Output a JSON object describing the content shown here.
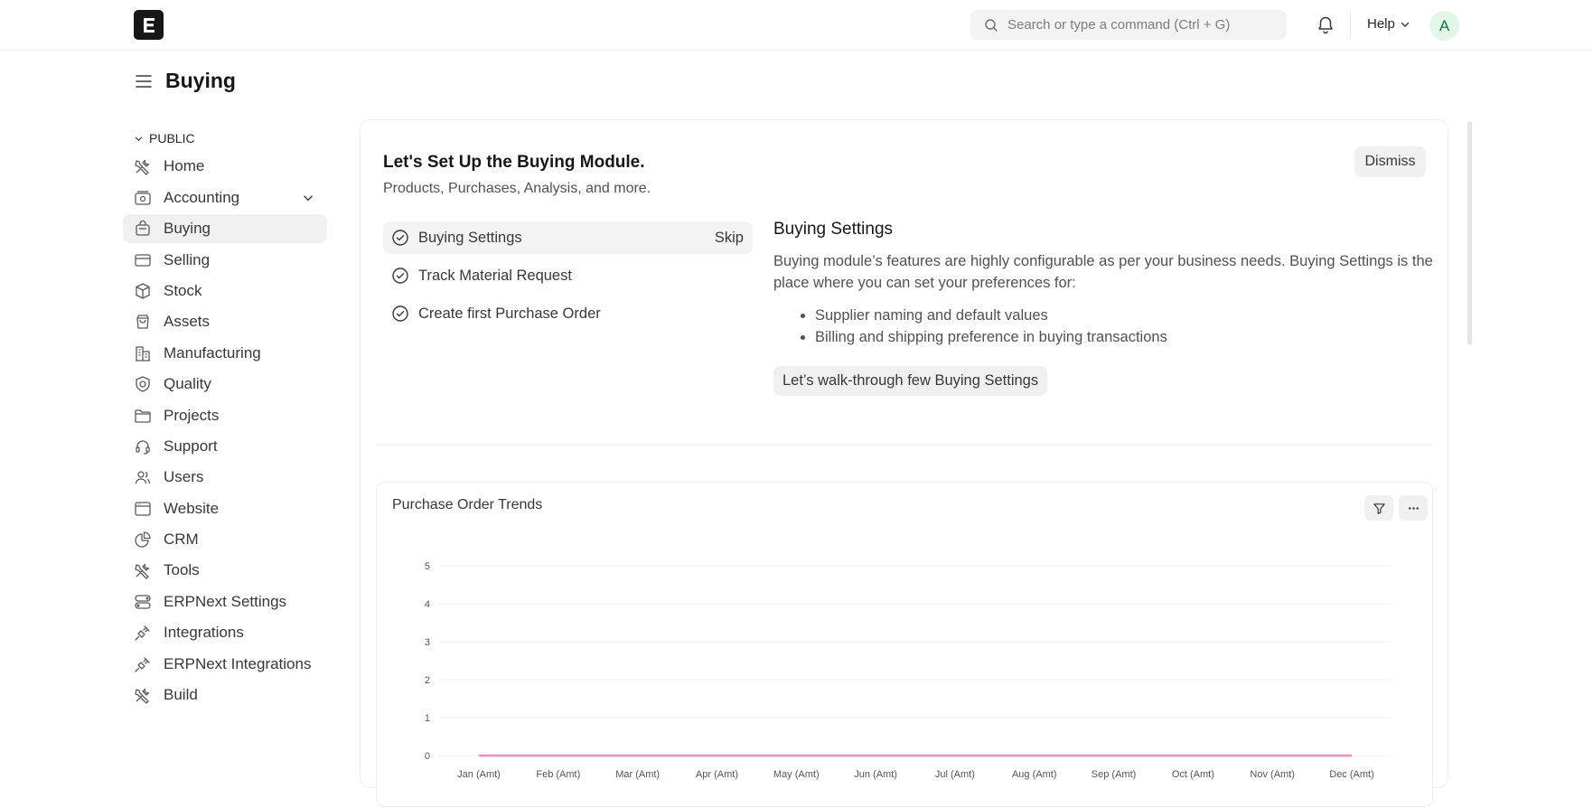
{
  "navbar": {
    "logo_letter": "E",
    "search_placeholder": "Search or type a command (Ctrl + G)",
    "help_label": "Help",
    "avatar_initial": "A"
  },
  "page": {
    "title": "Buying"
  },
  "sidebar": {
    "section_label": "PUBLIC",
    "items": [
      {
        "label": "Home",
        "icon": "tools-icon"
      },
      {
        "label": "Accounting",
        "icon": "accounting-icon"
      },
      {
        "label": "Buying",
        "icon": "buying-bag-icon",
        "active": true
      },
      {
        "label": "Selling",
        "icon": "selling-card-icon"
      },
      {
        "label": "Stock",
        "icon": "stock-box-icon"
      },
      {
        "label": "Assets",
        "icon": "assets-bag-icon"
      },
      {
        "label": "Manufacturing",
        "icon": "factory-icon"
      },
      {
        "label": "Quality",
        "icon": "quality-shield-icon"
      },
      {
        "label": "Projects",
        "icon": "folder-icon"
      },
      {
        "label": "Support",
        "icon": "headset-icon"
      },
      {
        "label": "Users",
        "icon": "users-icon"
      },
      {
        "label": "Website",
        "icon": "website-icon"
      },
      {
        "label": "CRM",
        "icon": "crm-pie-icon"
      },
      {
        "label": "Tools",
        "icon": "tools-icon"
      },
      {
        "label": "ERPNext Settings",
        "icon": "toggle-settings-icon"
      },
      {
        "label": "Integrations",
        "icon": "plug-icon"
      },
      {
        "label": "ERPNext Integrations",
        "icon": "plug-icon"
      },
      {
        "label": "Build",
        "icon": "tools-icon"
      }
    ]
  },
  "onboarding": {
    "title": "Let's Set Up the Buying Module.",
    "subtitle": "Products, Purchases, Analysis, and more.",
    "dismiss_label": "Dismiss",
    "steps": [
      {
        "label": "Buying Settings",
        "active": true,
        "action": "Skip"
      },
      {
        "label": "Track Material Request"
      },
      {
        "label": "Create first Purchase Order"
      }
    ],
    "detail": {
      "title": "Buying Settings",
      "description": "Buying module’s features are highly configurable as per your business needs. Buying Settings is the place where you can set your preferences for:",
      "bullets": [
        "Supplier naming and default values",
        "Billing and shipping preference in buying transactions"
      ],
      "action_label": "Let’s walk-through few Buying Settings"
    }
  },
  "widget": {
    "title": "Purchase Order Trends",
    "filter_icon": "filter-icon",
    "menu_icon": "more-horizontal-icon"
  },
  "chart_data": {
    "type": "line",
    "categories": [
      "Jan (Amt)",
      "Feb (Amt)",
      "Mar (Amt)",
      "Apr (Amt)",
      "May (Amt)",
      "Jun (Amt)",
      "Jul (Amt)",
      "Aug (Amt)",
      "Sep (Amt)",
      "Oct (Amt)",
      "Nov (Amt)",
      "Dec (Amt)"
    ],
    "series": [
      {
        "values": [
          0,
          0,
          0,
          0,
          0,
          0,
          0,
          0,
          0,
          0,
          0,
          0
        ],
        "color": "#f08ac0"
      }
    ],
    "yticks": [
      0,
      1,
      2,
      3,
      4,
      5
    ],
    "ylim": [
      0,
      5
    ],
    "grid": true
  }
}
